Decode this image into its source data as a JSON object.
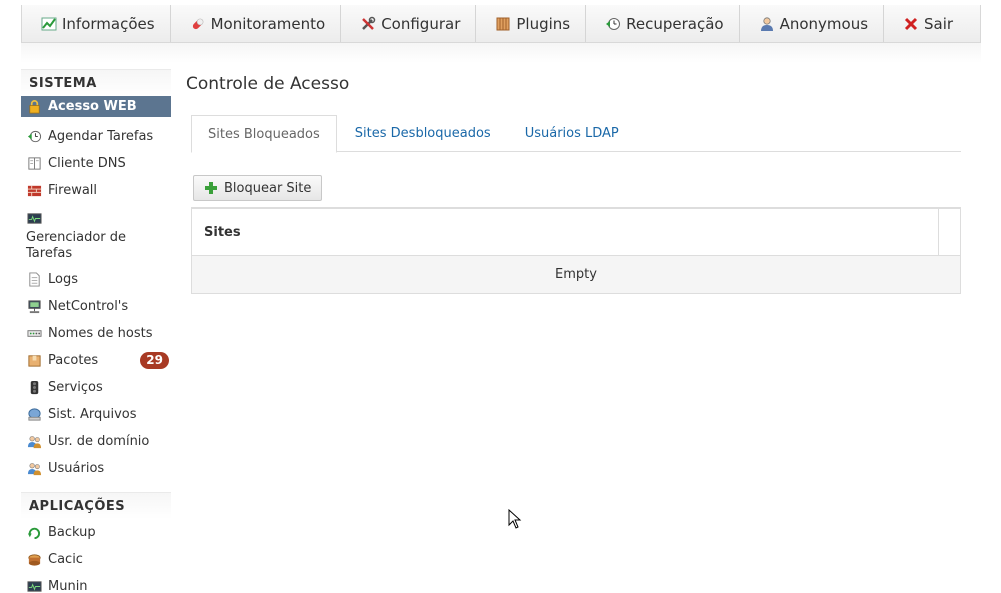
{
  "topnav": {
    "items": [
      {
        "label": "Informações",
        "icon": "chart-icon"
      },
      {
        "label": "Monitoramento",
        "icon": "pill-icon"
      },
      {
        "label": "Configurar",
        "icon": "tools-icon"
      },
      {
        "label": "Plugins",
        "icon": "plugin-box-icon"
      },
      {
        "label": "Recuperação",
        "icon": "restore-icon"
      },
      {
        "label": "Anonymous",
        "icon": "user-icon"
      },
      {
        "label": "Sair",
        "icon": "close-icon"
      }
    ]
  },
  "sidebar": {
    "sistema_header": "SISTEMA",
    "sistema_items": [
      {
        "label": "Acesso WEB",
        "icon": "lock-icon"
      },
      {
        "label": "Agendar Tarefas",
        "icon": "schedule-icon"
      },
      {
        "label": "Cliente DNS",
        "icon": "book-icon"
      },
      {
        "label": "Firewall",
        "icon": "firewall-icon"
      },
      {
        "label": "Gerenciador de Tarefas",
        "icon": "monitor-icon"
      },
      {
        "label": "Logs",
        "icon": "document-icon"
      },
      {
        "label": "NetControl's",
        "icon": "network-icon"
      },
      {
        "label": "Nomes de hosts",
        "icon": "hosts-icon"
      },
      {
        "label": "Pacotes",
        "icon": "package-icon",
        "badge": "29"
      },
      {
        "label": "Serviços",
        "icon": "traffic-light-icon"
      },
      {
        "label": "Sist. Arquivos",
        "icon": "disk-icon"
      },
      {
        "label": "Usr. de domínio",
        "icon": "users-icon"
      },
      {
        "label": "Usuários",
        "icon": "users-icon"
      }
    ],
    "aplicacoes_header": "APLICAÇÕES",
    "aplicacoes_items": [
      {
        "label": "Backup",
        "icon": "backup-icon"
      },
      {
        "label": "Cacic",
        "icon": "cacic-icon"
      },
      {
        "label": "Munin",
        "icon": "monitor-icon"
      }
    ]
  },
  "main": {
    "title": "Controle de Acesso",
    "tabs": [
      {
        "label": "Sites Bloqueados",
        "active": true
      },
      {
        "label": "Sites Desbloqueados",
        "active": false
      },
      {
        "label": "Usuários LDAP",
        "active": false
      }
    ],
    "add_button": "Bloquear Site",
    "grid": {
      "columns": [
        "Sites"
      ],
      "empty_text": "Empty"
    }
  },
  "colors": {
    "active_sidebar": "#5c7590",
    "link": "#1a68a8",
    "badge": "#a83a24",
    "add_green": "#3aa03a"
  }
}
